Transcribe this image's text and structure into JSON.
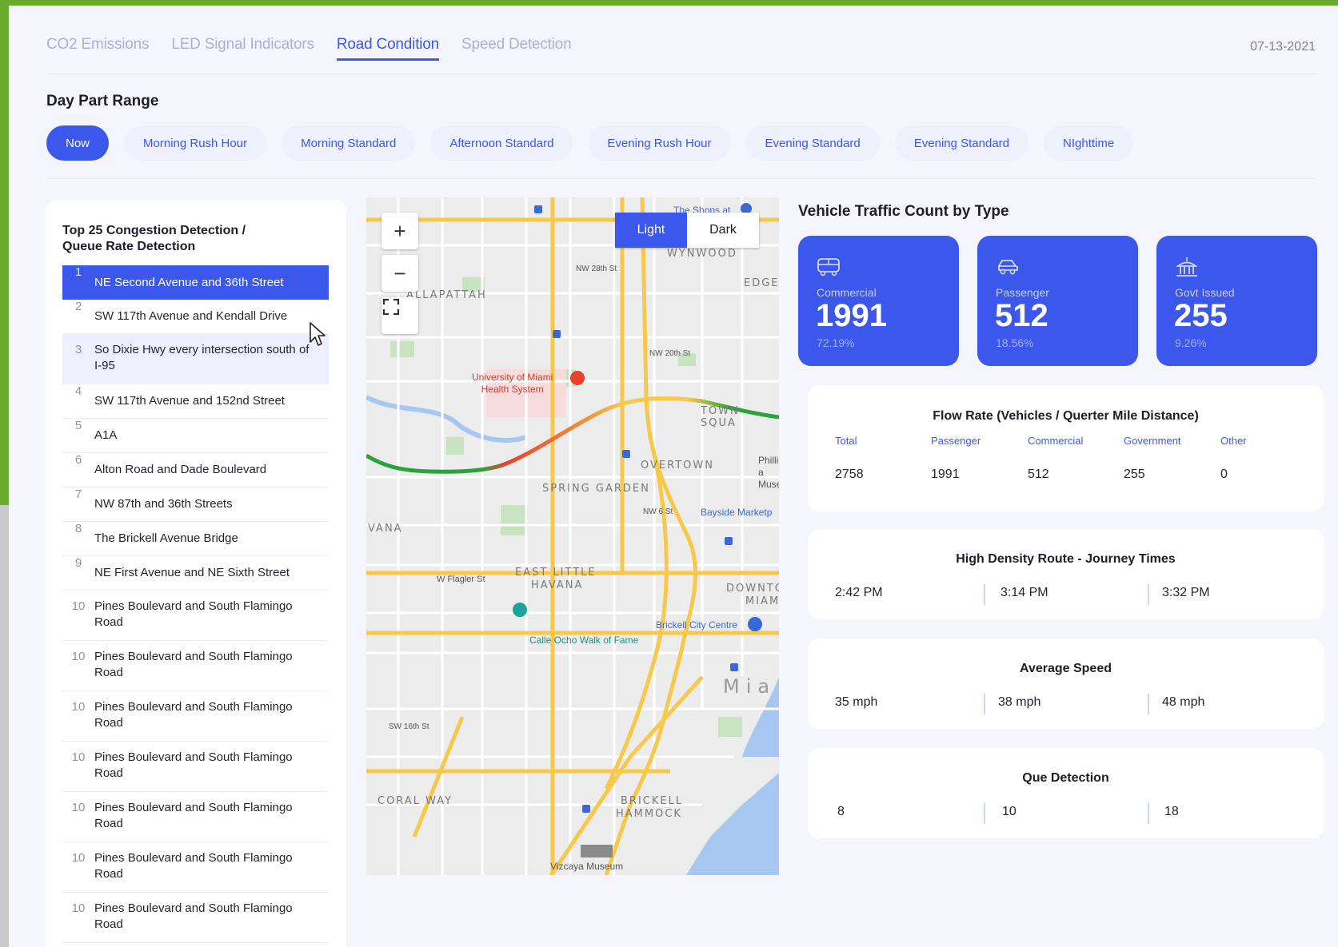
{
  "tabs": [
    {
      "label": "CO2 Emissions"
    },
    {
      "label": "LED Signal Indicators"
    },
    {
      "label": "Road Condition"
    },
    {
      "label": "Speed Detection"
    }
  ],
  "date": "07-13-2021",
  "day_part": {
    "title": "Day Part Range",
    "chips": [
      "Now",
      "Morning Rush Hour",
      "Morning Standard",
      "Afternoon Standard",
      "Evening Rush Hour",
      "Evening Standard",
      "Evening Standard",
      "NIghttime"
    ]
  },
  "congestion": {
    "title": "Top 25 Congestion Detection / Queue Rate Detection",
    "title_line1": "Top 25 Congestion Detection /",
    "title_line2": "Queue Rate Detection",
    "rows": [
      {
        "num": "1",
        "label": "NE Second Avenue and 36th Street"
      },
      {
        "num": "2",
        "label": "SW 117th Avenue and Kendall Drive"
      },
      {
        "num": "3",
        "label": "So Dixie Hwy every intersection south of I-95"
      },
      {
        "num": "4",
        "label": "SW 117th Avenue and 152nd Street"
      },
      {
        "num": "5",
        "label": "A1A"
      },
      {
        "num": "6",
        "label": "Alton Road and Dade Boulevard"
      },
      {
        "num": "7",
        "label": "NW 87th and 36th Streets"
      },
      {
        "num": "8",
        "label": "The Brickell Avenue Bridge"
      },
      {
        "num": "9",
        "label": "NE First Avenue and NE Sixth Street"
      },
      {
        "num": "10",
        "label": "Pines Boulevard and South Flamingo Road"
      },
      {
        "num": "10",
        "label": "Pines Boulevard and South Flamingo Road"
      },
      {
        "num": "10",
        "label": "Pines Boulevard and South Flamingo Road"
      },
      {
        "num": "10",
        "label": "Pines Boulevard and South Flamingo Road"
      },
      {
        "num": "10",
        "label": "Pines Boulevard and South Flamingo Road"
      },
      {
        "num": "10",
        "label": "Pines Boulevard and South Flamingo Road"
      },
      {
        "num": "10",
        "label": "Pines Boulevard and South Flamingo Road"
      }
    ]
  },
  "map": {
    "zoom_in": "+",
    "zoom_out": "−",
    "toggle_light": "Light",
    "toggle_dark": "Dark",
    "labels": {
      "wynwood": "WYNWOOD",
      "allapattah": "ALLAPATTAH",
      "edge": "EDGE",
      "town_square": "TOWN SQUA",
      "overtown": "OVERTOWN",
      "spring_garden": "SPRING GARDEN",
      "vana": "VANA",
      "east_little_havana_1": "EAST LITTLE",
      "east_little_havana_2": "HAVANA",
      "downtown_1": "DOWNTO",
      "downtown_2": "MIAM",
      "mia": "Mia",
      "coral_way": "CORAL WAY",
      "brickell_1": "BRICKELL",
      "brickell_2": "HAMMOCK",
      "umiami_1": "University of Miami",
      "umiami_2": "Health System",
      "shops": "The Shops at",
      "bayside": "Bayside Marketp",
      "phillip_1": "Phillip a",
      "phillip_2": "Muse",
      "brickell_city": "Brickell City Centre",
      "calle_ocho": "Calle Ocho Walk of Fame",
      "vizcaya": "Vizcaya Museum",
      "flagler": "W Flagler St",
      "nw28": "NW 28th St",
      "nw20": "NW 20th St",
      "nw6": "NW 6 St",
      "sw16": "SW 16th St"
    }
  },
  "vehicle_traffic": {
    "title": "Vehicle Traffic Count by Type",
    "cards": [
      {
        "label": "Commercial",
        "value": "1991",
        "pct": "72.19%",
        "icon": "bus-icon"
      },
      {
        "label": "Passenger",
        "value": "512",
        "pct": "18.56%",
        "icon": "car-icon"
      },
      {
        "label": "Govt Issued",
        "value": "255",
        "pct": "9.26%",
        "icon": "government-building-icon"
      }
    ]
  },
  "flow_rate": {
    "title": "Flow Rate (Vehicles / Querter Mile Distance)",
    "headers": [
      "Total",
      "Passenger",
      "Commercial",
      "Government",
      "Other"
    ],
    "values": [
      "2758",
      "1991",
      "512",
      "255",
      "0"
    ]
  },
  "journey_times": {
    "title": "High Density Route - Journey Times",
    "values": [
      "2:42 PM",
      "3:14 PM",
      "3:32 PM"
    ]
  },
  "average_speed": {
    "title": "Average Speed",
    "values": [
      "35 mph",
      "38 mph",
      "48 mph"
    ]
  },
  "que_detection": {
    "title": "Que Detection",
    "values": [
      "8",
      "10",
      "18"
    ]
  },
  "colors": {
    "accent": "#3b57ec",
    "frame_green": "#6aaa2f",
    "background": "#f5f6fd",
    "traffic_green": "#2aa43a",
    "traffic_red": "#e8412c",
    "road_yellow": "#f7c84a"
  }
}
